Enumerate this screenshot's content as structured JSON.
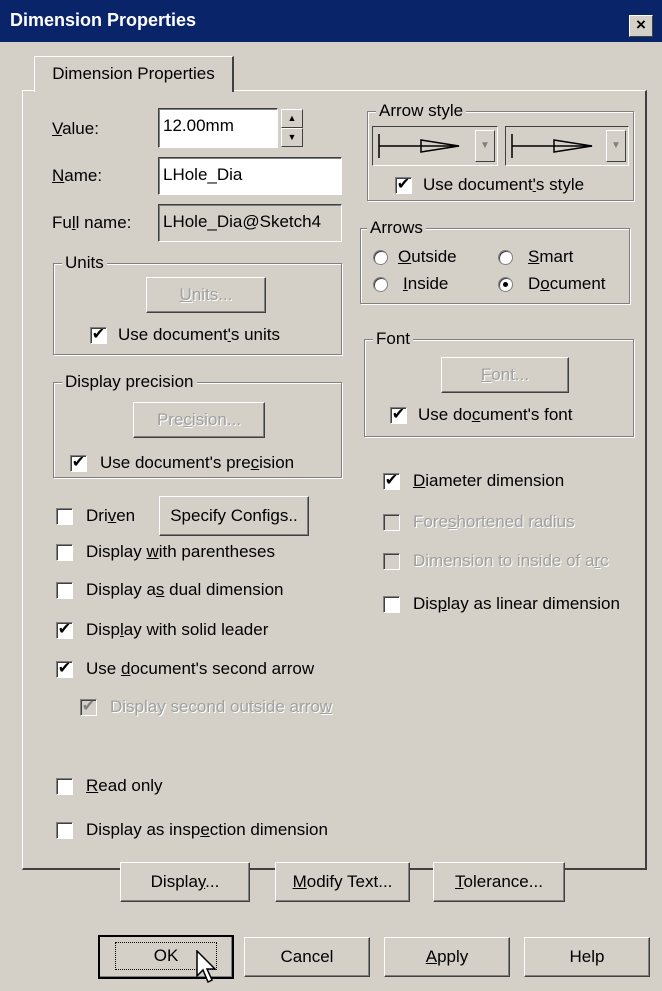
{
  "window": {
    "title": "Dimension Properties",
    "close_label": "×"
  },
  "tab": {
    "label": "Dimension Properties"
  },
  "fields": {
    "value_label_pre": "",
    "value_label_u": "V",
    "value_label_post": "alue:",
    "value": "12.00mm",
    "name_label_u": "N",
    "name_label_post": "ame:",
    "name": "LHole_Dia",
    "fullname_label_pre": "Fu",
    "fullname_label_u": "l",
    "fullname_label_post": "l name:",
    "fullname": "LHole_Dia@Sketch4"
  },
  "units": {
    "title": "Units",
    "button_u": "U",
    "button_post": "nits...",
    "use_doc_pre": "Use document",
    "use_doc_u": "'",
    "use_doc_post": "s units",
    "use_doc_checked": true
  },
  "precision": {
    "title": "Display precision",
    "button_pre": "Pre",
    "button_u": "c",
    "button_post": "ision...",
    "use_doc_pre": "Use document's pre",
    "use_doc_u": "c",
    "use_doc_post": "ision",
    "use_doc_checked": true
  },
  "options_left": [
    {
      "pre": "Dri",
      "u": "v",
      "post": "en",
      "checked": false,
      "disabled": false
    },
    {
      "pre": "Display ",
      "u": "w",
      "post": "ith parentheses",
      "checked": false,
      "disabled": false
    },
    {
      "pre": "Display a",
      "u": "s",
      "post": " dual dimension",
      "checked": false,
      "disabled": false
    },
    {
      "pre": "Disp",
      "u": "l",
      "post": "ay with solid leader",
      "checked": true,
      "disabled": false
    },
    {
      "pre": "Use ",
      "u": "d",
      "post": "ocument's second arrow",
      "checked": true,
      "disabled": false
    },
    {
      "pre": "Display second outside arro",
      "u": "w",
      "post": "",
      "checked": true,
      "disabled": true
    },
    {
      "pre": "",
      "u": "R",
      "post": "ead only",
      "checked": false,
      "disabled": false
    },
    {
      "pre": "Display as insp",
      "u": "e",
      "post": "ction dimension",
      "checked": false,
      "disabled": false
    }
  ],
  "specify_configs": {
    "label": "Specify Configs.."
  },
  "arrow_style": {
    "title": "Arrow style",
    "use_doc_pre": "Use document",
    "use_doc_u": "'",
    "use_doc_post": "s style",
    "use_doc_checked": true
  },
  "arrows": {
    "title": "Arrows",
    "options": [
      {
        "u": "O",
        "post": "utside",
        "selected": false
      },
      {
        "u": "S",
        "post": "mart",
        "selected": false
      },
      {
        "u": "I",
        "post": "nside",
        "selected": false
      },
      {
        "pre": "D",
        "u": "o",
        "post": "cument",
        "selected": true
      }
    ]
  },
  "font": {
    "title": "Font",
    "button_u": "F",
    "button_post": "ont...",
    "use_doc_pre": "Use do",
    "use_doc_u": "c",
    "use_doc_post": "ument's font",
    "use_doc_checked": true
  },
  "options_right": [
    {
      "pre": "",
      "u": "D",
      "post": "iameter dimension",
      "checked": true,
      "disabled": false
    },
    {
      "pre": "Fore",
      "u": "s",
      "post": "hortened radius",
      "checked": false,
      "disabled": true
    },
    {
      "pre": "Dimension to inside of a",
      "u": "r",
      "post": "c",
      "checked": false,
      "disabled": true
    },
    {
      "pre": "Dis",
      "u": "p",
      "post": "lay as linear dimension",
      "checked": false,
      "disabled": false
    }
  ],
  "bottom_buttons": {
    "display_pre": "Displa",
    "display_u": "y",
    "display_post": "...",
    "modify_u": "M",
    "modify_post": "odify Text...",
    "tolerance_u": "T",
    "tolerance_post": "olerance..."
  },
  "dialog_buttons": {
    "ok": "OK",
    "cancel": "Cancel",
    "apply_u": "A",
    "apply_post": "pply",
    "help": "Help"
  }
}
